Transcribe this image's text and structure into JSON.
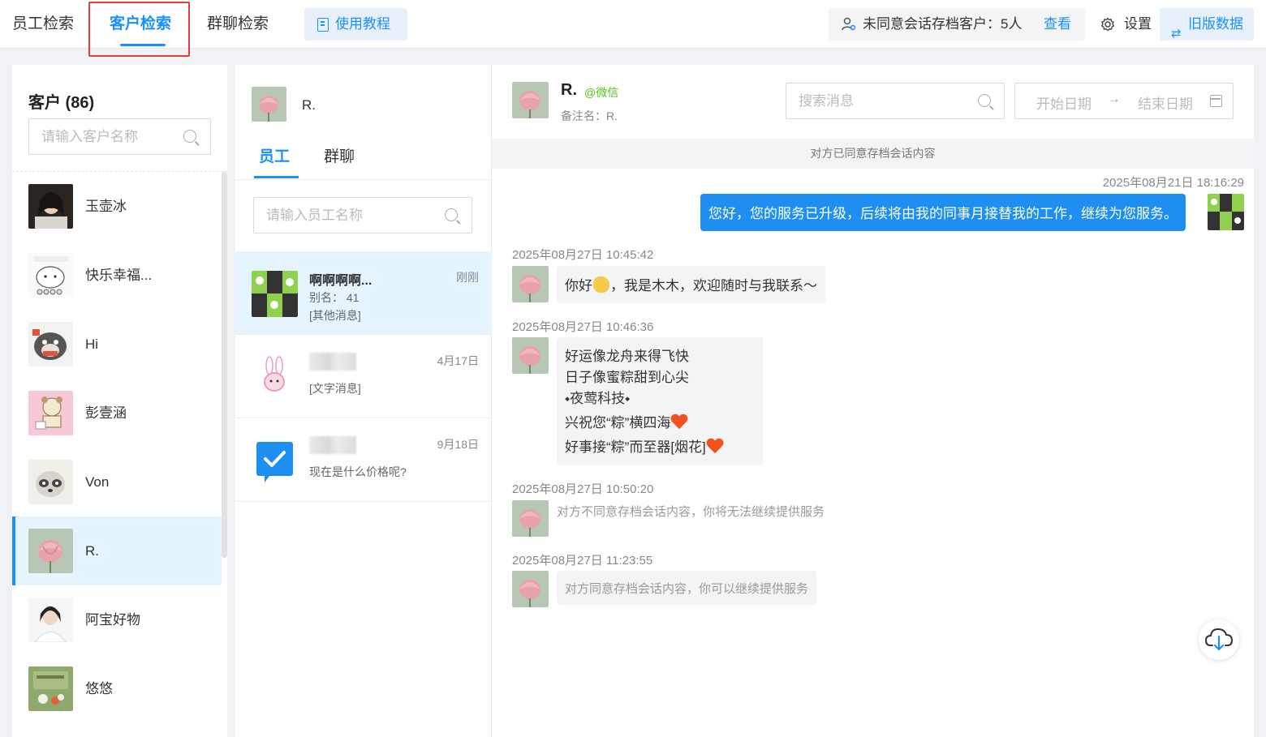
{
  "top_tabs": [
    {
      "label": "员工检索"
    },
    {
      "label": "客户检索"
    },
    {
      "label": "群聊检索"
    }
  ],
  "tutorial_label": "使用教程",
  "consent_summary": {
    "text": "未同意会话存档客户：5人",
    "view_label": "查看"
  },
  "settings_label": "设置",
  "old_data_label": "旧版数据",
  "left_panel": {
    "title": "客户 (86)",
    "search_placeholder": "请输入客户名称",
    "customers": [
      {
        "name": "玉壶冰",
        "avatar": "portrait-woman"
      },
      {
        "name": "快乐幸福...",
        "avatar": "cartoon-cat"
      },
      {
        "name": "Hi",
        "avatar": "cartoon-tiger"
      },
      {
        "name": "彭壹涵",
        "avatar": "cartoon-bear"
      },
      {
        "name": "Von",
        "avatar": "cartoon-raccoon"
      },
      {
        "name": "R.",
        "avatar": "lotus-flower"
      },
      {
        "name": "阿宝好物",
        "avatar": "portrait-woman-white"
      },
      {
        "name": "悠悠",
        "avatar": "cartoon-green-card"
      }
    ]
  },
  "mid_panel": {
    "customer_name": "R.",
    "tabs": [
      {
        "label": "员工"
      },
      {
        "label": "群聊"
      }
    ],
    "search_placeholder": "请输入员工名称",
    "staff": [
      {
        "name": "啊啊啊啊...",
        "time": "刚刚",
        "alias": "别名：  41",
        "last": "[其他消息]",
        "avatar": "comic-collage"
      },
      {
        "name": "",
        "time": "4月17日",
        "alias": "",
        "last": "[文字消息]",
        "avatar": "cartoon-bunny"
      },
      {
        "name": "",
        "time": "9月18日",
        "alias": "",
        "last": "现在是什么价格呢?",
        "avatar": "check-chat"
      }
    ]
  },
  "chat": {
    "name": "R.",
    "source": "@微信",
    "remark": "备注名：R.",
    "search_placeholder": "搜索消息",
    "start_date_placeholder": "开始日期",
    "end_date_placeholder": "结束日期",
    "arrow": "→",
    "consent_banner": "对方已同意存档会话内容",
    "messages": [
      {
        "time": "2025年08月21日 18:16:29",
        "text": "您好，您的服务已升级，后续将由我的同事月接替我的工作，继续为您服务。"
      },
      {
        "time": "2025年08月27日 10:45:42",
        "text_a": "你好",
        "text_b": "，我是木木，欢迎随时与我联系～"
      },
      {
        "time": "2025年08月27日 10:46:36",
        "lines": [
          "好运像龙舟来得飞快",
          "日子像蜜粽甜到心尖",
          "⬩夜莺科技⬩",
          "兴祝您“粽”横四海",
          "好事接“粽”而至器[烟花]"
        ]
      },
      {
        "time": "2025年08月27日 10:50:20",
        "text": "对方不同意存档会话内容，你将无法继续提供服务"
      },
      {
        "time": "2025年08月27日 11:23:55",
        "text": "对方同意存档会话内容，你可以继续提供服务"
      }
    ]
  },
  "colors": {
    "accent": "#1890ff",
    "highlight_border": "#e23c3c",
    "bubble_right": "#1e8ff0",
    "wechat_green": "#52c41a"
  }
}
